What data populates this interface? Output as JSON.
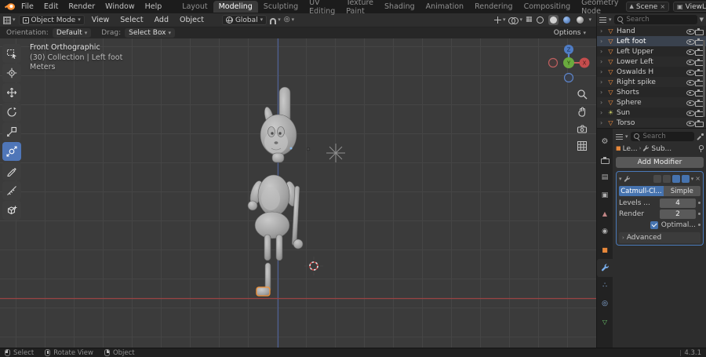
{
  "topbar": {
    "menus": [
      "File",
      "Edit",
      "Render",
      "Window",
      "Help"
    ],
    "workspaces": [
      "Layout",
      "Modeling",
      "Sculpting",
      "UV Editing",
      "Texture Paint",
      "Shading",
      "Animation",
      "Rendering",
      "Compositing",
      "Geometry Node"
    ],
    "active_workspace": "Modeling",
    "scene": "Scene",
    "view_layer": "ViewLayer"
  },
  "viewport_header": {
    "mode": "Object Mode",
    "menus": [
      "View",
      "Select",
      "Add",
      "Object"
    ],
    "orientation": "Global"
  },
  "tool_settings": {
    "orientation_label": "Orientation:",
    "orientation_value": "Default",
    "drag_label": "Drag:",
    "drag_value": "Select Box",
    "options_label": "Options"
  },
  "viewport": {
    "overlay_line1": "Front Orthographic",
    "overlay_line2": "(30) Collection | Left foot",
    "overlay_line3": "Meters",
    "gizmo": {
      "x": "X",
      "y": "Y",
      "z": "Z"
    }
  },
  "outliner": {
    "search_placeholder": "Search",
    "items": [
      {
        "name": "Hand"
      },
      {
        "name": "Left foot"
      },
      {
        "name": "Left Upper"
      },
      {
        "name": "Lower Left"
      },
      {
        "name": "Oswalds H"
      },
      {
        "name": "Right spike"
      },
      {
        "name": "Shorts"
      },
      {
        "name": "Sphere"
      },
      {
        "name": "Sun"
      },
      {
        "name": "Torso"
      }
    ]
  },
  "properties": {
    "search_placeholder": "Search",
    "breadcrumb": {
      "object": "Le...",
      "modifier": "Sub..."
    },
    "add_modifier_label": "Add Modifier",
    "modifier": {
      "type_active": "Catmull-Cl...",
      "type_inactive": "Simple",
      "fields": [
        {
          "label": "Levels ...",
          "value": "4"
        },
        {
          "label": "Render",
          "value": "2"
        }
      ],
      "optimal_label": "Optimal...",
      "advanced_label": "Advanced"
    }
  },
  "status_bar": {
    "hints": [
      "Select",
      "Rotate View",
      "Object"
    ],
    "version": "4.3.1"
  },
  "icons": {
    "chevron_down": "▾",
    "chevron_right": "›",
    "close": "×",
    "mesh": "▽",
    "sun": "☀",
    "gear": "⚙",
    "printer": "▤",
    "layers": "▣",
    "scene": "▲",
    "world": "◉",
    "object": "■",
    "particles": "∴",
    "physics": "◎",
    "data": "▽",
    "proportional": "◎",
    "funnel": "▼",
    "xray": "▦"
  },
  "colors": {
    "accent_blue": "#4772b3",
    "selection_orange": "#e8883a",
    "viewport_bg": "#3b3b3b"
  }
}
